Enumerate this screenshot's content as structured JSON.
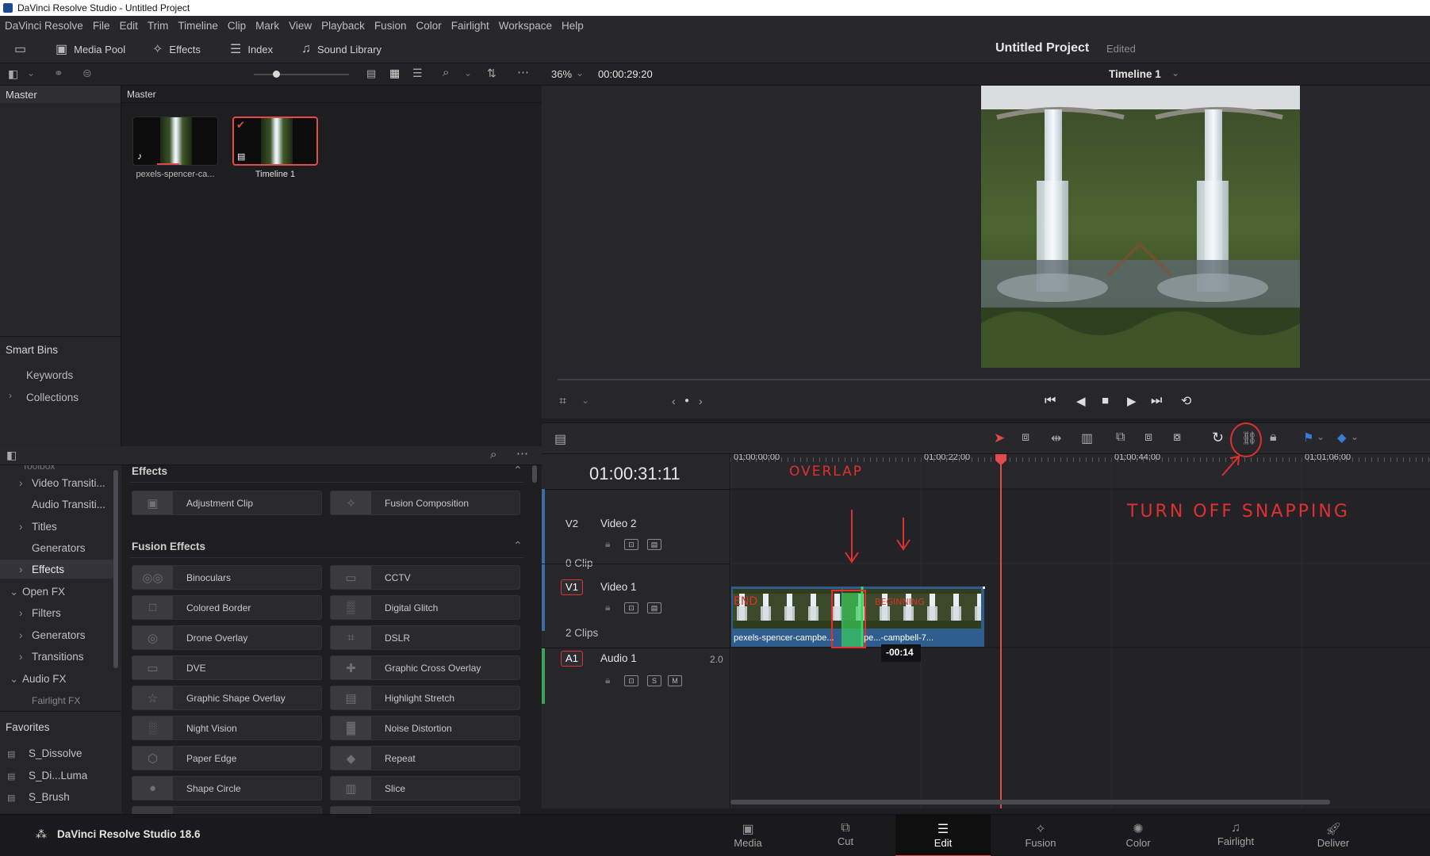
{
  "window": {
    "title": "DaVinci Resolve Studio - Untitled Project"
  },
  "menu": [
    "DaVinci Resolve",
    "File",
    "Edit",
    "Trim",
    "Timeline",
    "Clip",
    "Mark",
    "View",
    "Playback",
    "Fusion",
    "Color",
    "Fairlight",
    "Workspace",
    "Help"
  ],
  "toolbar": {
    "media_pool": "Media Pool",
    "effects": "Effects",
    "index": "Index",
    "sound_library": "Sound Library",
    "project_title": "Untitled Project",
    "project_status": "Edited"
  },
  "viewer": {
    "zoom": "36%",
    "timecode": "00:00:29:20",
    "timeline_name": "Timeline 1"
  },
  "bins": {
    "master_label": "Master",
    "pool_header": "Master",
    "smart_bins_label": "Smart Bins",
    "smart_bins": [
      "Keywords",
      "Collections"
    ]
  },
  "media_pool": {
    "items": [
      {
        "name": "pexels-spencer-ca...",
        "kind": "clip"
      },
      {
        "name": "Timeline 1",
        "kind": "timeline",
        "selected": true
      }
    ]
  },
  "effects_tree": {
    "partial_top": "Toolbox",
    "items": [
      {
        "label": "Video Transiti...",
        "chevron": true
      },
      {
        "label": "Audio Transiti...",
        "chevron": false
      },
      {
        "label": "Titles",
        "chevron": true
      },
      {
        "label": "Generators",
        "chevron": false
      },
      {
        "label": "Effects",
        "chevron": true,
        "active": true
      },
      {
        "label": "Open FX",
        "chevron": true,
        "open": true,
        "level0": true
      },
      {
        "label": "Filters",
        "chevron": true
      },
      {
        "label": "Generators",
        "chevron": true
      },
      {
        "label": "Transitions",
        "chevron": true
      },
      {
        "label": "Audio FX",
        "chevron": true,
        "open": true,
        "level0": true
      },
      {
        "label": "Fairlight FX",
        "chevron": false
      }
    ]
  },
  "effects_grid": {
    "section1": "Effects",
    "section1_items": [
      "Adjustment Clip",
      "Fusion Composition"
    ],
    "section2": "Fusion Effects",
    "section2_items": [
      "Binoculars",
      "CCTV",
      "Colored Border",
      "Digital Glitch",
      "Drone Overlay",
      "DSLR",
      "DVE",
      "Graphic Cross Overlay",
      "Graphic Shape Overlay",
      "Highlight Stretch",
      "Night Vision",
      "Noise Distortion",
      "Paper Edge",
      "Repeat",
      "Shape Circle",
      "Slice"
    ]
  },
  "favorites": {
    "label": "Favorites",
    "items": [
      "S_Dissolve",
      "S_Di...Luma",
      "S_Brush"
    ]
  },
  "timeline": {
    "timecode": "01:00:31:11",
    "ruler": [
      "01:00:00:00",
      "01:00:22:00",
      "01:00:44:00",
      "01:01:06:00"
    ],
    "tracks": [
      {
        "id": "V2",
        "name": "Video 2",
        "info": "0 Clip"
      },
      {
        "id": "V1",
        "name": "Video 1",
        "info": "2 Clips"
      },
      {
        "id": "A1",
        "name": "Audio 1",
        "channels": "2.0",
        "solo": "S",
        "mute": "M"
      }
    ],
    "clip1_label": "pexels-spencer-campbe...",
    "clip2_label": "pe...-campbell-7...",
    "drag_tooltip": "-00:14"
  },
  "annotations": {
    "overlap": "OVERLAP",
    "clip1_mark": "END",
    "clip2_mark": "BEGINNING",
    "snapping": "TURN OFF SNAPPING"
  },
  "pages": [
    "Media",
    "Cut",
    "Edit",
    "Fusion",
    "Color",
    "Fairlight",
    "Deliver"
  ],
  "active_page": "Edit",
  "app_version": "DaVinci Resolve Studio 18.6",
  "colors": {
    "accent_red": "#e14a4a",
    "clip_blue": "#2f5e8e",
    "annotation_red": "#e03030",
    "playhead": "#e34a4a",
    "edit_point": "#3bd65b"
  }
}
